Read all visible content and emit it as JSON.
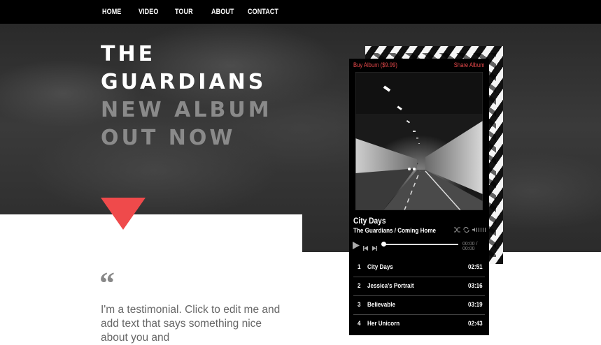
{
  "nav": {
    "items": [
      {
        "label": "HOME"
      },
      {
        "label": "VIDEO"
      },
      {
        "label": "TOUR"
      },
      {
        "label": "ABOUT"
      },
      {
        "label": "CONTACT"
      }
    ]
  },
  "hero": {
    "line1": "THE",
    "line2": "GUARDIANS",
    "line3": "NEW ALBUM",
    "line4": "OUT NOW",
    "accent_color": "#ef4a4b"
  },
  "testimonial": {
    "quote_mark": "“",
    "text": "I'm a testimonial. Click to edit me and add text that says something nice about you and"
  },
  "player": {
    "buy_label": "Buy Album ($9.99)",
    "share_label": "Share Album",
    "current_track": "City Days",
    "current_subtitle": "The Guardians / Coming Home",
    "time_display": "00:00 / 00:00",
    "link_color": "#e5484a",
    "tracks": [
      {
        "number": "1",
        "title": "City Days",
        "duration": "02:51"
      },
      {
        "number": "2",
        "title": "Jessica's Portrait",
        "duration": "03:16"
      },
      {
        "number": "3",
        "title": "Believable",
        "duration": "03:19"
      },
      {
        "number": "4",
        "title": "Her Unicorn",
        "duration": "02:43"
      }
    ]
  }
}
